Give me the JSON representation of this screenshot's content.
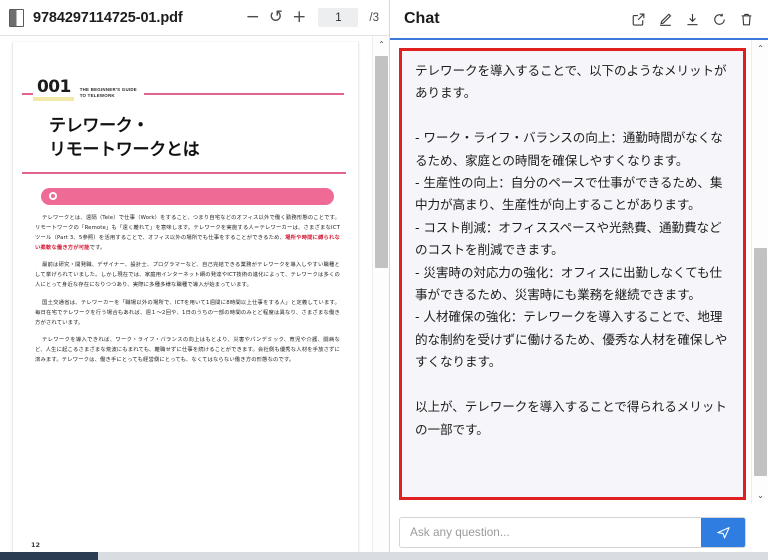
{
  "pdf": {
    "file_icon": "document-icon",
    "filename": "9784297114725-01.pdf",
    "zoom_out_label": "−",
    "rotate_label": "↺",
    "zoom_in_label": "+",
    "page_value": "1",
    "page_total": "/3",
    "page": {
      "chapter_number": "001",
      "chapter_en_line1": "THE BEGINNER'S GUIDE",
      "chapter_en_line2": "TO TELEWORK",
      "title_line1": "テレワーク・",
      "title_line2": "リモートワークとは",
      "paragraphs": [
        {
          "indent": true,
          "runs": [
            {
              "text": "テレワークとは、遠隔（Tele）で仕事（Work）をすること、つまり自宅などのオフィス以外で働く勤務形態のことです。リモートワークの「Remote」も「遠く離れて」を意味します。テレワークを実施する人＝テレワーカーは、さまざまなICTツール（Part 3、5参照）を活用することで、オフィス以外の場所でも仕事をすることができるため、",
              "style": "normal"
            },
            {
              "text": "場所や時間に縛られない柔軟な働き方が可能",
              "style": "highlight-red"
            },
            {
              "text": "です。",
              "style": "normal"
            }
          ]
        },
        {
          "indent": true,
          "runs": [
            {
              "text": "最前は研究・開発職、デザイナー、設計士、プログラマーなど、自己完結できる業務がテレワークを導入しやすい職種として挙げられていました。しかし現在では、家庭用インターネット網の発達やICT技術の進化によって、テレワークは多くの人にとって身近な存在になりつつあり、実際に多種多様な職種で導入が始まっています。",
              "style": "normal"
            }
          ]
        },
        {
          "indent": true,
          "runs": [
            {
              "text": "国土交通省は、テレワーカーを「職場以外の場所で、ICTを用いて1週間に8時間以上仕事をする人」と定義しています。毎日在宅でテレワークを行う場合もあれば、週１～2回や、1日のうちの一部の時間のみとど程度は異なり、さまざまな働き方がされています。",
              "style": "normal"
            }
          ]
        },
        {
          "indent": true,
          "runs": [
            {
              "text": "テレワークを導入できれば、ワーク・ライフ・バランスの向上はもとより、災害やパンデミック、育児や介護、闘病など、人生に起こるさまざまな荒波にもまれても、離職せずに仕事を続けることができます。会社側も優秀な人材を手放さずに済みます。テレワークは、働き手にとっても経営側にとっても、なくてはならない働き方の形態なのです。",
              "style": "normal"
            }
          ]
        }
      ],
      "folio": "12"
    },
    "scrollbar": {
      "up_arrow": "⌃",
      "down_arrow": "⌄"
    }
  },
  "chat": {
    "title": "Chat",
    "actions": [
      {
        "name": "share-icon",
        "label": "Share"
      },
      {
        "name": "edit-icon",
        "label": "Edit"
      },
      {
        "name": "download-icon",
        "label": "Download"
      },
      {
        "name": "refresh-icon",
        "label": "Refresh"
      },
      {
        "name": "trash-icon",
        "label": "Delete"
      }
    ],
    "accent_color": "#3b78d8",
    "highlight_border_color": "#e02020",
    "message": "テレワークを導入することで、以下のようなメリットがあります。\n\n- ワーク・ライフ・バランスの向上：通勤時間がなくなるため、家庭との時間を確保しやすくなります。\n- 生産性の向上：自分のペースで仕事ができるため、集中力が高まり、生産性が向上することがあります。\n- コスト削減：オフィススペースや光熱費、通勤費などのコストを削減できます。\n- 災害時の対応力の強化：オフィスに出勤しなくても仕事ができるため、災害時にも業務を継続できます。\n- 人材確保の強化：テレワークを導入することで、地理的な制約を受けずに働けるため、優秀な人材を確保しやすくなります。\n\n以上が、テレワークを導入することで得られるメリットの一部です。",
    "input_placeholder": "Ask any question...",
    "input_value": "",
    "send_icon": "send-icon",
    "scrollbar": {
      "up_arrow": "⌃",
      "down_arrow": "⌄"
    }
  }
}
